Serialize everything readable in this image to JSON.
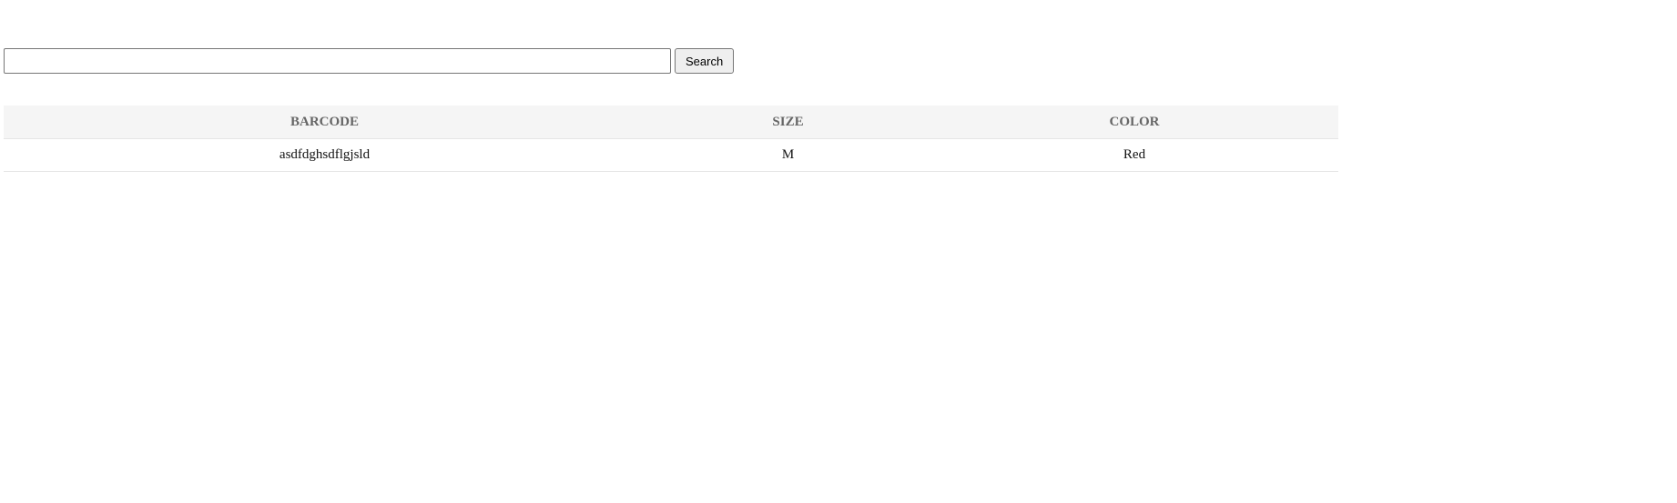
{
  "search": {
    "value": "",
    "placeholder": "",
    "button_label": "Search"
  },
  "table": {
    "columns": [
      "BARCODE",
      "SIZE",
      "COLOR"
    ],
    "rows": [
      {
        "barcode": "asdfdghsdflgjsld",
        "size": "M",
        "color": "Red"
      }
    ]
  },
  "colors": {
    "header_background": "#f5f5f5",
    "header_text": "#666666",
    "row_divider": "#e6e6e6"
  }
}
